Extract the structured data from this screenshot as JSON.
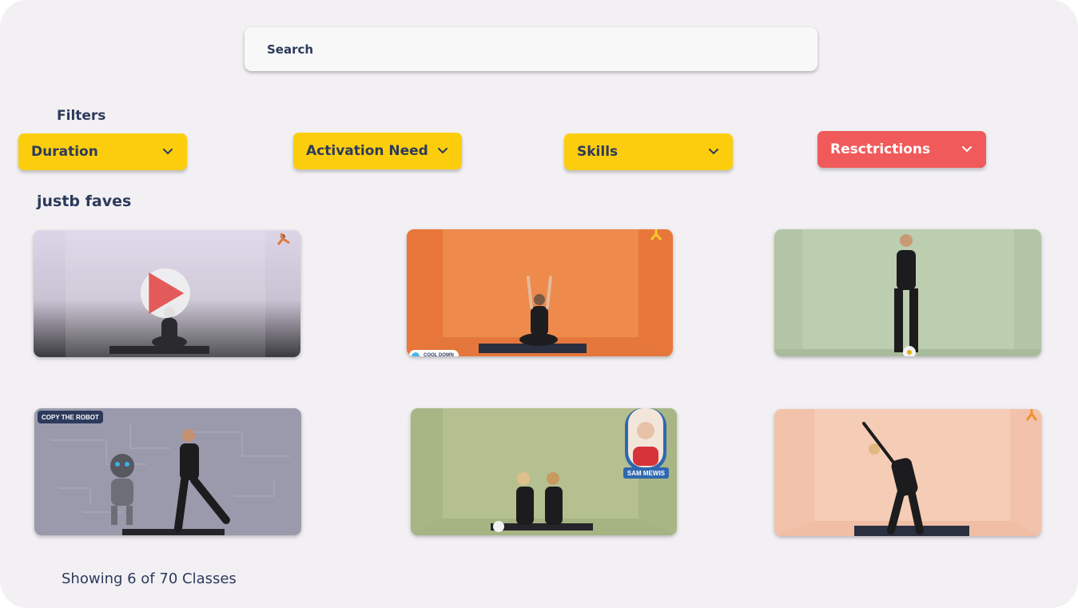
{
  "search": {
    "placeholder": "Search"
  },
  "filters": {
    "title": "Filters",
    "items": [
      {
        "label": "Duration",
        "color": "#fccd0c"
      },
      {
        "label": "Activation Need",
        "color": "#fccd0c"
      },
      {
        "label": "Skills",
        "color": "#fccd0c"
      },
      {
        "label": "Resctrictions",
        "color": "#f05a5a"
      }
    ]
  },
  "section": {
    "title": "justb faves"
  },
  "classes": [
    {
      "bg": "#d8d2e2",
      "badge": "",
      "presenter": "",
      "tag": ""
    },
    {
      "bg": "#e97a3e",
      "badge": "",
      "presenter": "",
      "tag": "COOL DOWN"
    },
    {
      "bg": "#b5c7a8",
      "badge": "",
      "presenter": "",
      "tag": ""
    },
    {
      "bg": "#9b9bab",
      "badge": "COPY THE ROBOT",
      "presenter": "",
      "tag": ""
    },
    {
      "bg": "#a9b586",
      "badge": "",
      "presenter": "SAM MEWIS",
      "tag": ""
    },
    {
      "bg": "#f2c3aa",
      "badge": "",
      "presenter": "",
      "tag": ""
    }
  ],
  "footer": {
    "text": "Showing 6 of 70 Classes"
  },
  "colors": {
    "accent_yellow": "#fccd0c",
    "accent_red": "#f05a5a",
    "navy": "#2c3a5c"
  },
  "icons": {
    "chevron": "chevron-down-icon",
    "play": "play-icon"
  }
}
